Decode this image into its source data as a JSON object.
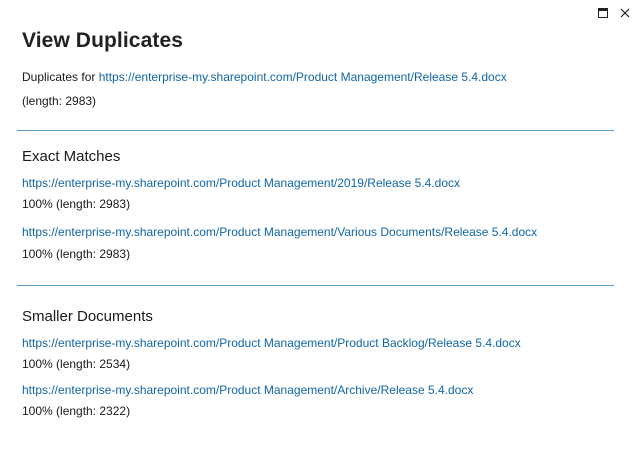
{
  "dialog": {
    "title": "View Duplicates",
    "duplicates_for_label": "Duplicates for",
    "source_url": "https://enterprise-my.sharepoint.com/Product Management/Release 5.4.docx",
    "source_length": "(length: 2983)"
  },
  "window_controls": {
    "maximize_icon": "maximize-icon",
    "close_icon": "close-icon"
  },
  "sections": {
    "exact": {
      "title": "Exact Matches",
      "items": [
        {
          "url": "https://enterprise-my.sharepoint.com/Product Management/2019/Release 5.4.docx",
          "meta": "100% (length: 2983)"
        },
        {
          "url": "https://enterprise-my.sharepoint.com/Product Management/Various Documents/Release 5.4.docx",
          "meta": "100% (length: 2983)"
        }
      ]
    },
    "smaller": {
      "title": "Smaller Documents",
      "items": [
        {
          "url": "https://enterprise-my.sharepoint.com/Product Management/Product Backlog/Release 5.4.docx",
          "meta": "100% (length: 2534)"
        },
        {
          "url": "https://enterprise-my.sharepoint.com/Product Management/Archive/Release 5.4.docx",
          "meta": "100% (length: 2322)"
        }
      ]
    }
  },
  "colors": {
    "link": "#1066a8",
    "divider": "#5a9cc8",
    "text": "#1a1a1a"
  }
}
